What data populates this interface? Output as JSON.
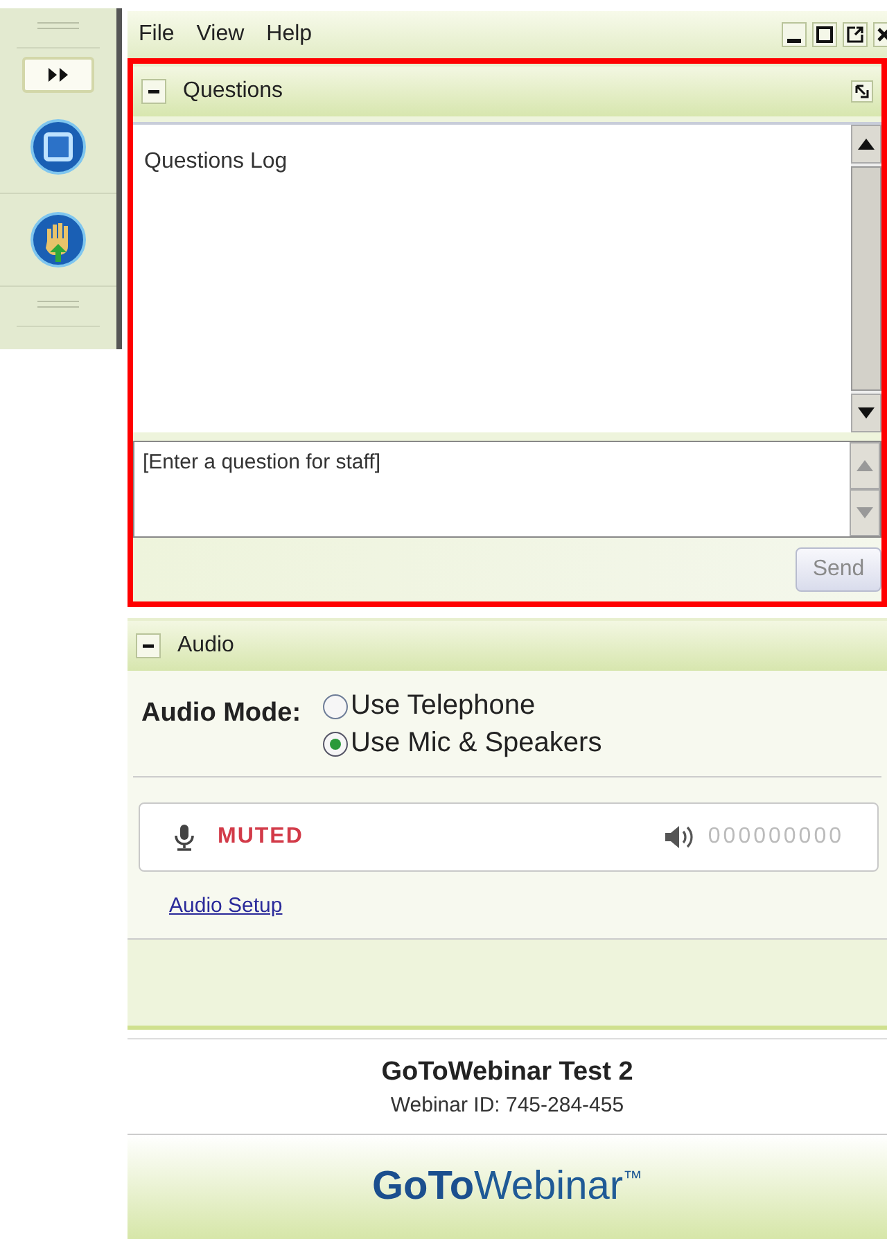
{
  "menu_bar": {
    "items": [
      "File",
      "View",
      "Help"
    ]
  },
  "questions_panel": {
    "title": "Questions",
    "expanded": true,
    "highlighted": true,
    "log_title": "Questions Log",
    "input": {
      "placeholder": "[Enter a question for staff]"
    },
    "send_button": {
      "label": "Send",
      "disabled": true
    }
  },
  "audio_panel": {
    "title": "Audio",
    "expanded": true,
    "mode_label": "Audio Mode:",
    "options": [
      {
        "label": "Use Telephone",
        "selected": false
      },
      {
        "label": "Use Mic & Speakers",
        "selected": true
      }
    ],
    "mic_status": "MUTED",
    "speaker_reading": "000000000",
    "setup_link": "Audio Setup"
  },
  "footer": {
    "title": "GoToWebinar Test 2",
    "webinar_id": "Webinar ID: 745-284-455",
    "logo": "**GoTo**Webinar$^{™}$"
  }
}
